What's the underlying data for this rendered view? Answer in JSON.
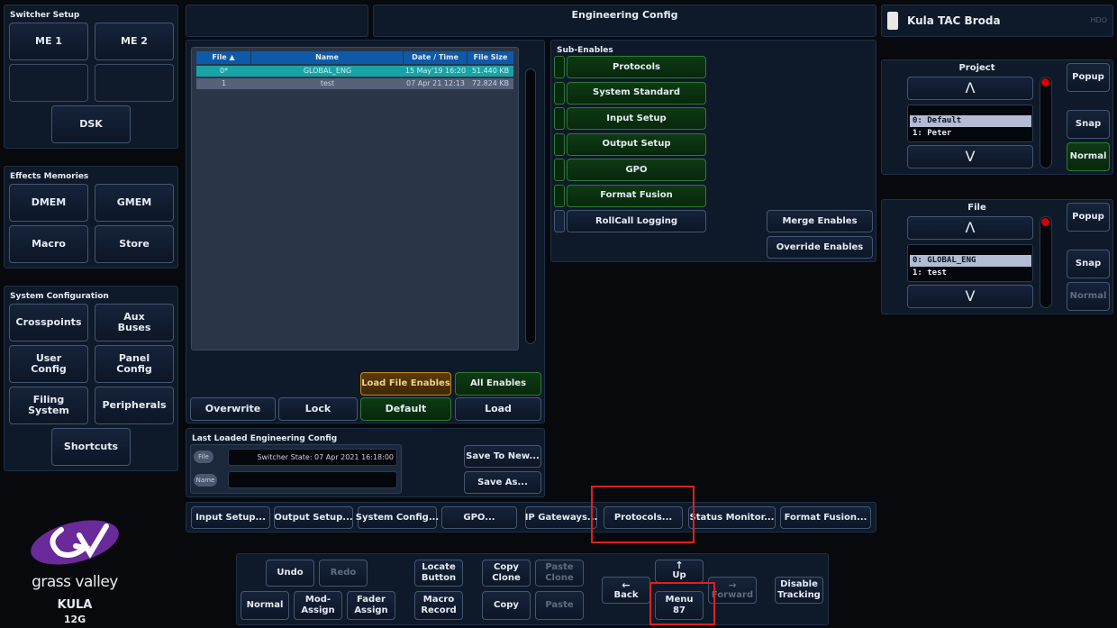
{
  "switcher_setup": {
    "title": "Switcher Setup",
    "me1": "ME 1",
    "me2": "ME 2",
    "dsk": "DSK"
  },
  "effects_memories": {
    "title": "Effects Memories",
    "dmem": "DMEM",
    "gmem": "GMEM",
    "macro": "Macro",
    "store": "Store"
  },
  "system_configuration": {
    "title": "System Configuration",
    "crosspoints": "Crosspoints",
    "aux_buses": "Aux\nBuses",
    "user_config": "User\nConfig",
    "panel_config": "Panel\nConfig",
    "filing_system": "Filing\nSystem",
    "peripherals": "Peripherals",
    "shortcuts": "Shortcuts"
  },
  "header": {
    "title": "Engineering Config",
    "device_name": "Kula TAC Broda",
    "device_tag": "HDO"
  },
  "files": {
    "columns": [
      "File ▲",
      "Name",
      "Date / Time",
      "File Size"
    ],
    "rows": [
      {
        "file": "0*",
        "name": "GLOBAL_ENG",
        "date": "15 May'19 16:20",
        "size": "51.440 KB",
        "selected": true
      },
      {
        "file": "1",
        "name": "test",
        "date": "07 Apr 21 12:13",
        "size": "72.824 KB",
        "selected": false
      }
    ]
  },
  "file_buttons": {
    "load_file_enables": "Load File Enables",
    "all_enables": "All Enables",
    "overwrite": "Overwrite",
    "lock": "Lock",
    "default": "Default",
    "load": "Load"
  },
  "sub_enables": {
    "title": "Sub-Enables",
    "items": [
      "Protocols",
      "System Standard",
      "Input Setup",
      "Output Setup",
      "GPO",
      "Format Fusion",
      "RollCall Logging"
    ],
    "merge": "Merge Enables",
    "override": "Override Enables"
  },
  "last_loaded": {
    "title": "Last Loaded Engineering Config",
    "file_label": "File",
    "file_value": "Switcher State:  07 Apr 2021 16:18:00",
    "name_label": "Name",
    "name_value": "",
    "save_to_new": "Save To New...",
    "save_as": "Save As..."
  },
  "project": {
    "title": "Project",
    "items": [
      "0:  Default",
      "1:  Peter"
    ],
    "up": "Λ",
    "down": "V",
    "popup": "Popup",
    "snap": "Snap",
    "normal": "Normal"
  },
  "file_list": {
    "title": "File",
    "items": [
      "0:  GLOBAL_ENG",
      "1:  test"
    ],
    "up": "Λ",
    "down": "V",
    "popup": "Popup",
    "snap": "Snap",
    "normal": "Normal"
  },
  "tabs": [
    "Input Setup...",
    "Output Setup...",
    "System Config...",
    "GPO...",
    "IP Gateways...",
    "Protocols...",
    "Status Monitor...",
    "Format Fusion..."
  ],
  "bottom": {
    "undo": "Undo",
    "redo": "Redo",
    "normal": "Normal",
    "mod_assign": "Mod-\nAssign",
    "fader_assign": "Fader\nAssign",
    "locate_button": "Locate\nButton",
    "macro_record": "Macro\nRecord",
    "copy_clone": "Copy\nClone",
    "paste_clone": "Paste\nClone",
    "copy": "Copy",
    "paste": "Paste",
    "up_arrow": "↑",
    "up": "Up",
    "back_arrow": "←",
    "back": "Back",
    "forward_arrow": "→",
    "forward": "Forward",
    "menu": "Menu\n87",
    "disable_tracking": "Disable\nTracking"
  },
  "logo": {
    "brand": "grass valley",
    "product": "KULA",
    "model": "12G"
  },
  "colors": {
    "background": "#07090d",
    "panel": "#0e1a2a",
    "button_border": "#43566f",
    "green_enable": "#0e3a14",
    "orange": "#c48a1a",
    "selection": "#1aa3a6",
    "red_highlight": "#e02020",
    "tally_red": "#d40000"
  }
}
